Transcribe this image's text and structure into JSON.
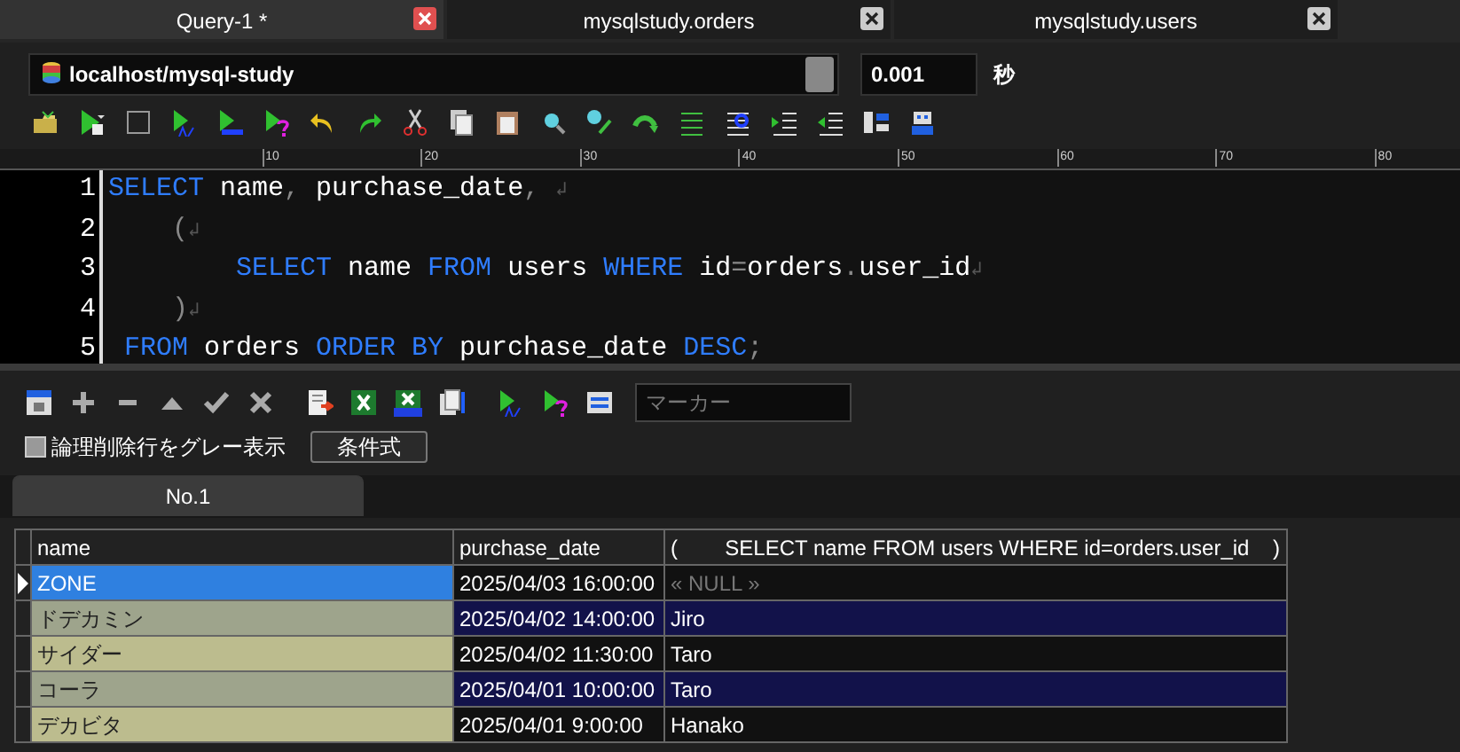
{
  "tabs": [
    {
      "label": "Query-1 *",
      "selected": true
    },
    {
      "label": "mysqlstudy.orders",
      "selected": false
    },
    {
      "label": "mysqlstudy.users",
      "selected": false
    }
  ],
  "connection": {
    "value": "localhost/mysql-study"
  },
  "elapsed": {
    "value": "0.001",
    "unit": "秒"
  },
  "ruler": {
    "labels": [
      "10",
      "20",
      "30",
      "40",
      "50",
      "60",
      "70",
      "80"
    ]
  },
  "editor": {
    "lines": [
      {
        "number": "1",
        "tokens": [
          {
            "text": "SELECT",
            "kind": "keyword"
          },
          {
            "text": " name",
            "kind": "ident"
          },
          {
            "text": ",",
            "kind": "punct"
          },
          {
            "text": " purchase_date",
            "kind": "ident"
          },
          {
            "text": ", ",
            "kind": "punct"
          },
          {
            "text": "↲",
            "kind": "eol"
          }
        ]
      },
      {
        "number": "2",
        "tokens": [
          {
            "text": "    (",
            "kind": "punct"
          },
          {
            "text": "↲",
            "kind": "eol"
          }
        ]
      },
      {
        "number": "3",
        "tokens": [
          {
            "text": "        SELECT",
            "kind": "keyword"
          },
          {
            "text": " name ",
            "kind": "ident"
          },
          {
            "text": "FROM",
            "kind": "keyword"
          },
          {
            "text": " users ",
            "kind": "ident"
          },
          {
            "text": "WHERE",
            "kind": "keyword"
          },
          {
            "text": " id",
            "kind": "ident"
          },
          {
            "text": "=",
            "kind": "punct"
          },
          {
            "text": "orders",
            "kind": "ident"
          },
          {
            "text": ".",
            "kind": "punct"
          },
          {
            "text": "user_id",
            "kind": "ident"
          },
          {
            "text": "↲",
            "kind": "eol"
          }
        ]
      },
      {
        "number": "4",
        "tokens": [
          {
            "text": "    )",
            "kind": "punct"
          },
          {
            "text": "↲",
            "kind": "eol"
          }
        ]
      },
      {
        "number": "5",
        "tokens": [
          {
            "text": " FROM",
            "kind": "keyword"
          },
          {
            "text": " orders ",
            "kind": "ident"
          },
          {
            "text": "ORDER BY",
            "kind": "keyword"
          },
          {
            "text": " purchase_date ",
            "kind": "ident"
          },
          {
            "text": "DESC",
            "kind": "keyword"
          },
          {
            "text": ";",
            "kind": "punct"
          }
        ]
      }
    ]
  },
  "marker": {
    "placeholder": "マーカー"
  },
  "gray_deleted": {
    "label": "論理削除行をグレー表示",
    "checked": false
  },
  "condition_button": "条件式",
  "result_tabs": [
    {
      "label": "No.1",
      "selected": true
    }
  ],
  "table": {
    "columns": [
      "name",
      "purchase_date",
      "(        SELECT name FROM users WHERE id=orders.user_id    )"
    ],
    "rows": [
      {
        "selected": true,
        "cells": [
          {
            "text": "ZONE",
            "null": false
          },
          {
            "text": "2025/04/03 16:00:00",
            "null": false
          },
          {
            "text": "« NULL »",
            "null": true
          }
        ]
      },
      {
        "selected": false,
        "cells": [
          {
            "text": "ドデカミン",
            "null": false
          },
          {
            "text": "2025/04/02 14:00:00",
            "null": false
          },
          {
            "text": "Jiro",
            "null": false
          }
        ]
      },
      {
        "selected": false,
        "cells": [
          {
            "text": "サイダー",
            "null": false
          },
          {
            "text": "2025/04/02 11:30:00",
            "null": false
          },
          {
            "text": "Taro",
            "null": false
          }
        ]
      },
      {
        "selected": false,
        "cells": [
          {
            "text": "コーラ",
            "null": false
          },
          {
            "text": "2025/04/01 10:00:00",
            "null": false
          },
          {
            "text": "Taro",
            "null": false
          }
        ]
      },
      {
        "selected": false,
        "cells": [
          {
            "text": "デカビタ",
            "null": false
          },
          {
            "text": "2025/04/01 9:00:00",
            "null": false
          },
          {
            "text": "Hanako",
            "null": false
          }
        ]
      }
    ]
  }
}
